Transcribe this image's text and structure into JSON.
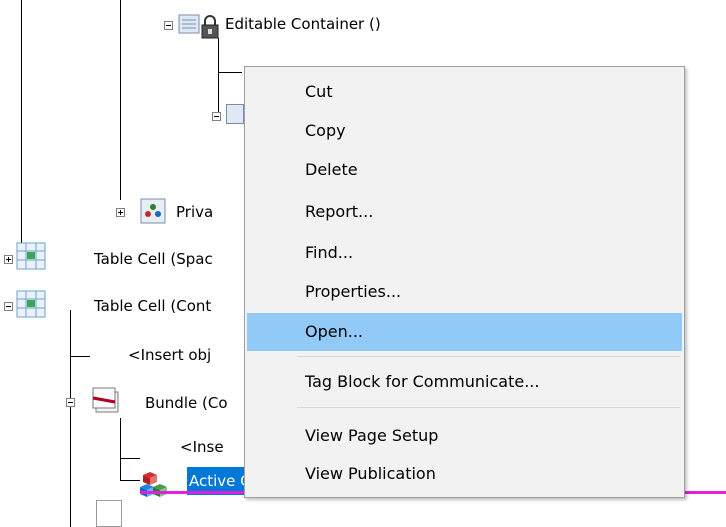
{
  "tree": {
    "editable_container": "Editable Container ()",
    "private_label": "Priva",
    "table_cell_1": "Table Cell (Spac",
    "table_cell_2": "Table Cell (Cont",
    "insert_obj": "<Insert obj",
    "bundle": "Bundle (Co",
    "insert_2": "<Inse",
    "active_content": "Active Content (Contact Us Box)"
  },
  "context_menu": {
    "items": [
      {
        "label": "Cut"
      },
      {
        "label": "Copy"
      },
      {
        "label": "Delete"
      },
      {
        "label": "Report..."
      },
      {
        "label": "Find..."
      },
      {
        "label": "Properties..."
      },
      {
        "label": "Open...",
        "highlighted": true
      },
      {
        "label": "Tag Block for Communicate..."
      },
      {
        "label": "View Page Setup"
      },
      {
        "label": "View Publication"
      }
    ]
  },
  "colors": {
    "selection": "#0078d7",
    "menu_highlight": "#91c9f7",
    "menu_background": "#f2f2f2",
    "frame_line": "#e020e0"
  }
}
